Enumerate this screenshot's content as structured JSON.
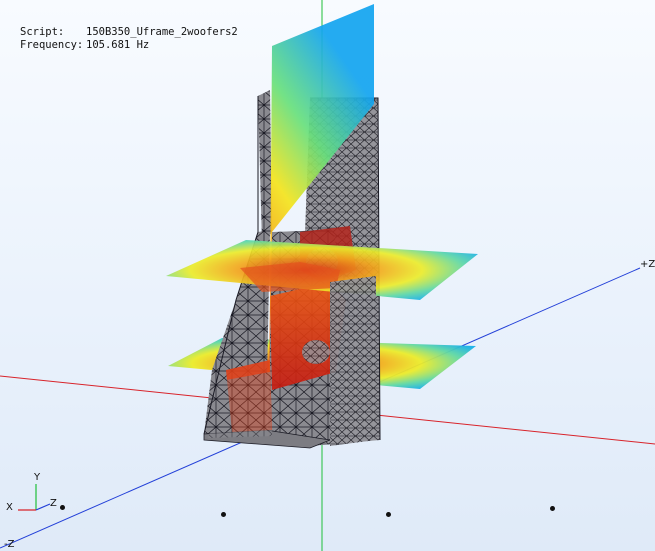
{
  "info": {
    "script_label": "Script:",
    "script_value": "150B350_Uframe_2woofers2",
    "frequency_label": "Frequency:",
    "frequency_value": "105.681 Hz"
  },
  "axes": {
    "plus_z": "+Z",
    "minus_z": "-Z",
    "triad_y": "Y",
    "triad_x": "X",
    "triad_z": "Z"
  },
  "colors": {
    "x_axis": "#d8232a",
    "y_axis": "#1fbf3a",
    "z_axis": "#2340d8",
    "mesh_face": "#8c8c90",
    "mesh_line": "#1a1a22"
  }
}
